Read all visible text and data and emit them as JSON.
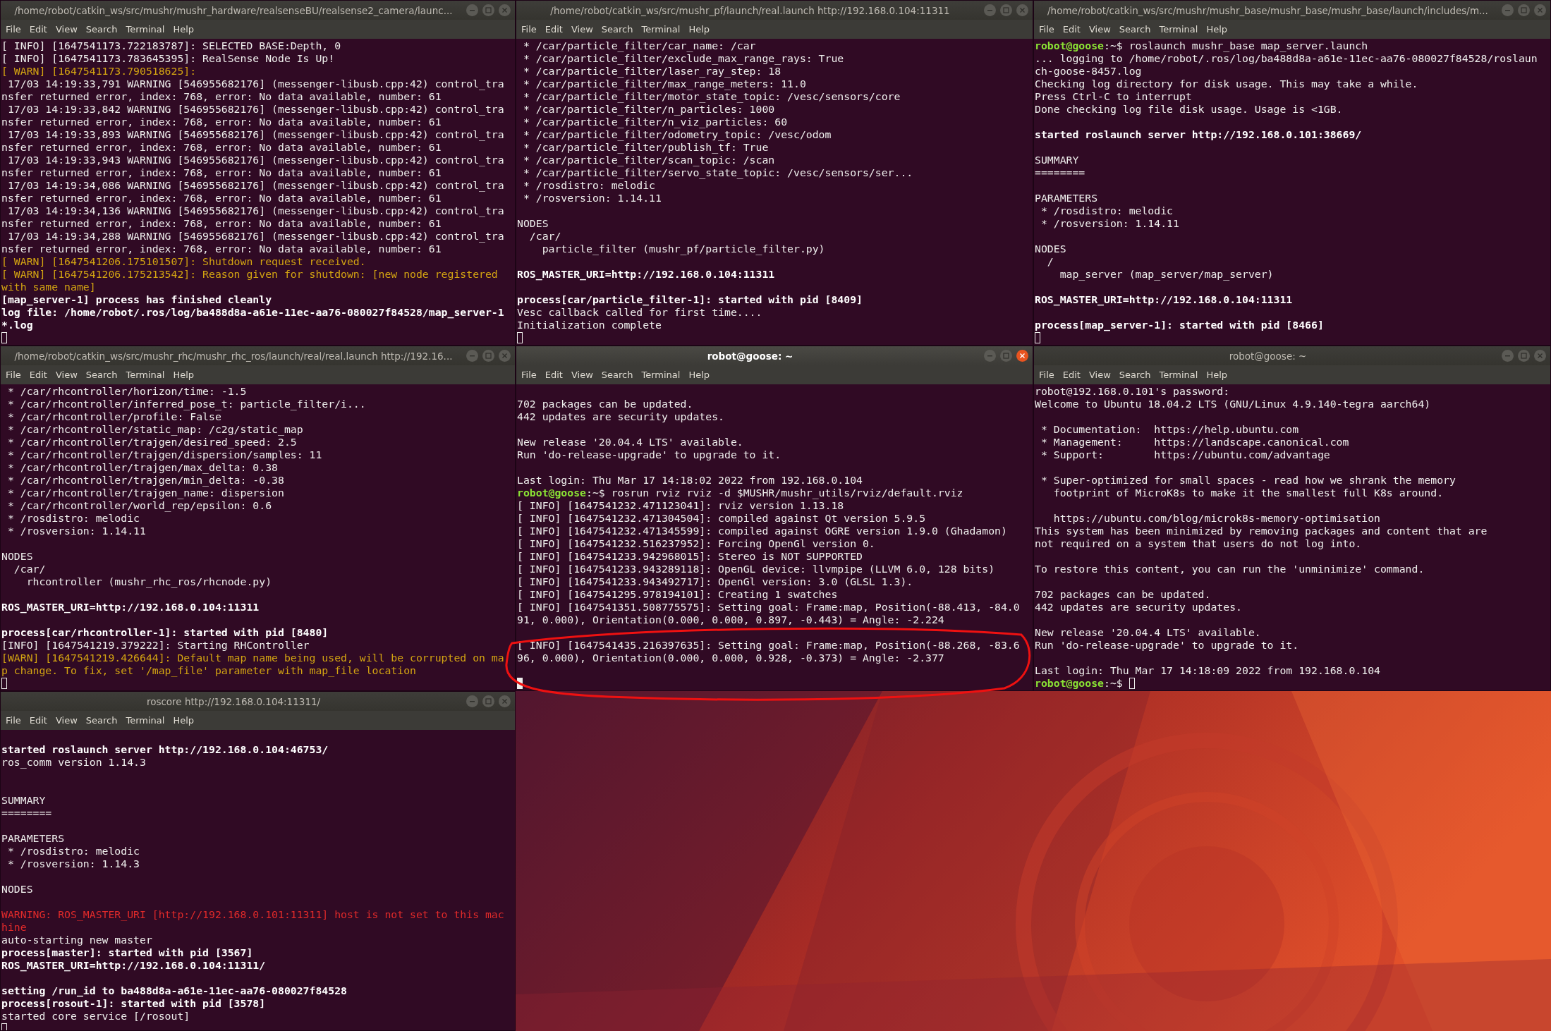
{
  "windows": [
    {
      "title": "/home/robot/catkin_ws/src/mushr/mushr_hardware/realsenseBU/realsense2_camera/launc...",
      "focused": false,
      "cursor_inline": false,
      "menu": [
        "File",
        "Edit",
        "View",
        "Search",
        "Terminal",
        "Help"
      ],
      "lines": [
        {
          "kind": "normal",
          "text": "[ INFO] [1647541173.722183787]: SELECTED BASE:Depth, 0"
        },
        {
          "kind": "normal",
          "text": "[ INFO] [1647541173.783645395]: RealSense Node Is Up!"
        },
        {
          "kind": "warn",
          "text": "[ WARN] [1647541173.790518625]:"
        },
        {
          "kind": "normal",
          "text": " 17/03 14:19:33,791 WARNING [546955682176] (messenger-libusb.cpp:42) control_tra"
        },
        {
          "kind": "normal",
          "text": "nsfer returned error, index: 768, error: No data available, number: 61"
        },
        {
          "kind": "normal",
          "text": " 17/03 14:19:33,842 WARNING [546955682176] (messenger-libusb.cpp:42) control_tra"
        },
        {
          "kind": "normal",
          "text": "nsfer returned error, index: 768, error: No data available, number: 61"
        },
        {
          "kind": "normal",
          "text": " 17/03 14:19:33,893 WARNING [546955682176] (messenger-libusb.cpp:42) control_tra"
        },
        {
          "kind": "normal",
          "text": "nsfer returned error, index: 768, error: No data available, number: 61"
        },
        {
          "kind": "normal",
          "text": " 17/03 14:19:33,943 WARNING [546955682176] (messenger-libusb.cpp:42) control_tra"
        },
        {
          "kind": "normal",
          "text": "nsfer returned error, index: 768, error: No data available, number: 61"
        },
        {
          "kind": "normal",
          "text": " 17/03 14:19:34,086 WARNING [546955682176] (messenger-libusb.cpp:42) control_tra"
        },
        {
          "kind": "normal",
          "text": "nsfer returned error, index: 768, error: No data available, number: 61"
        },
        {
          "kind": "normal",
          "text": " 17/03 14:19:34,136 WARNING [546955682176] (messenger-libusb.cpp:42) control_tra"
        },
        {
          "kind": "normal",
          "text": "nsfer returned error, index: 768, error: No data available, number: 61"
        },
        {
          "kind": "normal",
          "text": " 17/03 14:19:34,288 WARNING [546955682176] (messenger-libusb.cpp:42) control_tra"
        },
        {
          "kind": "normal",
          "text": "nsfer returned error, index: 768, error: No data available, number: 61"
        },
        {
          "kind": "warn",
          "text": "[ WARN] [1647541206.175101507]: Shutdown request received."
        },
        {
          "kind": "warn",
          "text": "[ WARN] [1647541206.175213542]: Reason given for shutdown: [new node registered"
        },
        {
          "kind": "warn",
          "text": "with same name]"
        },
        {
          "kind": "bold",
          "text": "[map_server-1] process has finished cleanly"
        },
        {
          "kind": "bold",
          "text": "log file: /home/robot/.ros/log/ba488d8a-a61e-11ec-aa76-080027f84528/map_server-1"
        },
        {
          "kind": "bold",
          "text": "*.log"
        }
      ]
    },
    {
      "title": "/home/robot/catkin_ws/src/mushr_pf/launch/real.launch http://192.168.0.104:11311",
      "focused": false,
      "cursor_inline": false,
      "menu": [
        "File",
        "Edit",
        "View",
        "Search",
        "Terminal",
        "Help"
      ],
      "lines": [
        {
          "kind": "normal",
          "text": " * /car/particle_filter/car_name: /car"
        },
        {
          "kind": "normal",
          "text": " * /car/particle_filter/exclude_max_range_rays: True"
        },
        {
          "kind": "normal",
          "text": " * /car/particle_filter/laser_ray_step: 18"
        },
        {
          "kind": "normal",
          "text": " * /car/particle_filter/max_range_meters: 11.0"
        },
        {
          "kind": "normal",
          "text": " * /car/particle_filter/motor_state_topic: /vesc/sensors/core"
        },
        {
          "kind": "normal",
          "text": " * /car/particle_filter/n_particles: 1000"
        },
        {
          "kind": "normal",
          "text": " * /car/particle_filter/n_viz_particles: 60"
        },
        {
          "kind": "normal",
          "text": " * /car/particle_filter/odometry_topic: /vesc/odom"
        },
        {
          "kind": "normal",
          "text": " * /car/particle_filter/publish_tf: True"
        },
        {
          "kind": "normal",
          "text": " * /car/particle_filter/scan_topic: /scan"
        },
        {
          "kind": "normal",
          "text": " * /car/particle_filter/servo_state_topic: /vesc/sensors/ser..."
        },
        {
          "kind": "normal",
          "text": " * /rosdistro: melodic"
        },
        {
          "kind": "normal",
          "text": " * /rosversion: 1.14.11"
        },
        {
          "kind": "blank"
        },
        {
          "kind": "normal",
          "text": "NODES"
        },
        {
          "kind": "normal",
          "text": "  /car/"
        },
        {
          "kind": "normal",
          "text": "    particle_filter (mushr_pf/particle_filter.py)"
        },
        {
          "kind": "blank"
        },
        {
          "kind": "bold",
          "text": "ROS_MASTER_URI=http://192.168.0.104:11311"
        },
        {
          "kind": "blank"
        },
        {
          "kind": "bold",
          "text": "process[car/particle_filter-1]: started with pid [8409]"
        },
        {
          "kind": "normal",
          "text": "Vesc callback called for first time...."
        },
        {
          "kind": "normal",
          "text": "Initialization complete"
        }
      ]
    },
    {
      "title": "/home/robot/catkin_ws/src/mushr/mushr_base/mushr_base/mushr_base/launch/includes/m...",
      "focused": false,
      "cursor_inline": false,
      "menu": [
        "File",
        "Edit",
        "View",
        "Search",
        "Terminal",
        "Help"
      ],
      "lines": [
        {
          "kind": "prompt",
          "user": "robot@goose",
          "text": ":~$ roslaunch mushr_base map_server.launch"
        },
        {
          "kind": "normal",
          "text": "... logging to /home/robot/.ros/log/ba488d8a-a61e-11ec-aa76-080027f84528/roslaun"
        },
        {
          "kind": "normal",
          "text": "ch-goose-8457.log"
        },
        {
          "kind": "normal",
          "text": "Checking log directory for disk usage. This may take a while."
        },
        {
          "kind": "normal",
          "text": "Press Ctrl-C to interrupt"
        },
        {
          "kind": "normal",
          "text": "Done checking log file disk usage. Usage is <1GB."
        },
        {
          "kind": "blank"
        },
        {
          "kind": "bold",
          "text": "started roslaunch server http://192.168.0.101:38669/"
        },
        {
          "kind": "blank"
        },
        {
          "kind": "normal",
          "text": "SUMMARY"
        },
        {
          "kind": "normal",
          "text": "========"
        },
        {
          "kind": "blank"
        },
        {
          "kind": "normal",
          "text": "PARAMETERS"
        },
        {
          "kind": "normal",
          "text": " * /rosdistro: melodic"
        },
        {
          "kind": "normal",
          "text": " * /rosversion: 1.14.11"
        },
        {
          "kind": "blank"
        },
        {
          "kind": "normal",
          "text": "NODES"
        },
        {
          "kind": "normal",
          "text": "  /"
        },
        {
          "kind": "normal",
          "text": "    map_server (map_server/map_server)"
        },
        {
          "kind": "blank"
        },
        {
          "kind": "bold",
          "text": "ROS_MASTER_URI=http://192.168.0.104:11311"
        },
        {
          "kind": "blank"
        },
        {
          "kind": "bold",
          "text": "process[map_server-1]: started with pid [8466]"
        }
      ]
    },
    {
      "title": "/home/robot/catkin_ws/src/mushr_rhc/mushr_rhc_ros/launch/real/real.launch http://192.16...",
      "focused": false,
      "cursor_inline": false,
      "menu": [
        "File",
        "Edit",
        "View",
        "Search",
        "Terminal",
        "Help"
      ],
      "lines": [
        {
          "kind": "normal",
          "text": " * /car/rhcontroller/horizon/time: -1.5"
        },
        {
          "kind": "normal",
          "text": " * /car/rhcontroller/inferred_pose_t: particle_filter/i..."
        },
        {
          "kind": "normal",
          "text": " * /car/rhcontroller/profile: False"
        },
        {
          "kind": "normal",
          "text": " * /car/rhcontroller/static_map: /c2g/static_map"
        },
        {
          "kind": "normal",
          "text": " * /car/rhcontroller/trajgen/desired_speed: 2.5"
        },
        {
          "kind": "normal",
          "text": " * /car/rhcontroller/trajgen/dispersion/samples: 11"
        },
        {
          "kind": "normal",
          "text": " * /car/rhcontroller/trajgen/max_delta: 0.38"
        },
        {
          "kind": "normal",
          "text": " * /car/rhcontroller/trajgen/min_delta: -0.38"
        },
        {
          "kind": "normal",
          "text": " * /car/rhcontroller/trajgen_name: dispersion"
        },
        {
          "kind": "normal",
          "text": " * /car/rhcontroller/world_rep/epsilon: 0.6"
        },
        {
          "kind": "normal",
          "text": " * /rosdistro: melodic"
        },
        {
          "kind": "normal",
          "text": " * /rosversion: 1.14.11"
        },
        {
          "kind": "blank"
        },
        {
          "kind": "normal",
          "text": "NODES"
        },
        {
          "kind": "normal",
          "text": "  /car/"
        },
        {
          "kind": "normal",
          "text": "    rhcontroller (mushr_rhc_ros/rhcnode.py)"
        },
        {
          "kind": "blank"
        },
        {
          "kind": "bold",
          "text": "ROS_MASTER_URI=http://192.168.0.104:11311"
        },
        {
          "kind": "blank"
        },
        {
          "kind": "bold",
          "text": "process[car/rhcontroller-1]: started with pid [8480]"
        },
        {
          "kind": "normal",
          "text": "[INFO] [1647541219.379222]: Starting RHController"
        },
        {
          "kind": "warn",
          "text": "[WARN] [1647541219.426644]: Default map name being used, will be corrupted on ma"
        },
        {
          "kind": "warn",
          "text": "p change. To fix, set '/map_file' parameter with map_file location"
        }
      ]
    },
    {
      "title": "robot@goose: ~",
      "focused": true,
      "cursor_inline": false,
      "menu": [
        "File",
        "Edit",
        "View",
        "Search",
        "Terminal",
        "Help"
      ],
      "lines": [
        {
          "kind": "blank"
        },
        {
          "kind": "normal",
          "text": "702 packages can be updated."
        },
        {
          "kind": "normal",
          "text": "442 updates are security updates."
        },
        {
          "kind": "blank"
        },
        {
          "kind": "normal",
          "text": "New release '20.04.4 LTS' available."
        },
        {
          "kind": "normal",
          "text": "Run 'do-release-upgrade' to upgrade to it."
        },
        {
          "kind": "blank"
        },
        {
          "kind": "normal",
          "text": "Last login: Thu Mar 17 14:18:02 2022 from 192.168.0.104"
        },
        {
          "kind": "prompt",
          "user": "robot@goose",
          "text": ":~$ rosrun rviz rviz -d $MUSHR/mushr_utils/rviz/default.rviz"
        },
        {
          "kind": "normal",
          "text": "[ INFO] [1647541232.471123041]: rviz version 1.13.18"
        },
        {
          "kind": "normal",
          "text": "[ INFO] [1647541232.471304504]: compiled against Qt version 5.9.5"
        },
        {
          "kind": "normal",
          "text": "[ INFO] [1647541232.471345599]: compiled against OGRE version 1.9.0 (Ghadamon)"
        },
        {
          "kind": "normal",
          "text": "[ INFO] [1647541232.516237952]: Forcing OpenGl version 0."
        },
        {
          "kind": "normal",
          "text": "[ INFO] [1647541233.942968015]: Stereo is NOT SUPPORTED"
        },
        {
          "kind": "normal",
          "text": "[ INFO] [1647541233.943289118]: OpenGL device: llvmpipe (LLVM 6.0, 128 bits)"
        },
        {
          "kind": "normal",
          "text": "[ INFO] [1647541233.943492717]: OpenGl version: 3.0 (GLSL 1.3)."
        },
        {
          "kind": "normal",
          "text": "[ INFO] [1647541295.978194101]: Creating 1 swatches"
        },
        {
          "kind": "normal",
          "text": "[ INFO] [1647541351.508775575]: Setting goal: Frame:map, Position(-88.413, -84.0"
        },
        {
          "kind": "normal",
          "text": "91, 0.000), Orientation(0.000, 0.000, 0.897, -0.443) = Angle: -2.224"
        },
        {
          "kind": "blank"
        },
        {
          "kind": "normal",
          "text": "[ INFO] [1647541435.216397635]: Setting goal: Frame:map, Position(-88.268, -83.6"
        },
        {
          "kind": "normal",
          "text": "96, 0.000), Orientation(0.000, 0.000, 0.928, -0.373) = Angle: -2.377"
        },
        {
          "kind": "blank"
        }
      ]
    },
    {
      "title": "robot@goose: ~",
      "focused": false,
      "cursor_inline": true,
      "menu": [
        "File",
        "Edit",
        "View",
        "Search",
        "Terminal",
        "Help"
      ],
      "lines": [
        {
          "kind": "normal",
          "text": "robot@192.168.0.101's password:"
        },
        {
          "kind": "normal",
          "text": "Welcome to Ubuntu 18.04.2 LTS (GNU/Linux 4.9.140-tegra aarch64)"
        },
        {
          "kind": "blank"
        },
        {
          "kind": "normal",
          "text": " * Documentation:  https://help.ubuntu.com"
        },
        {
          "kind": "normal",
          "text": " * Management:     https://landscape.canonical.com"
        },
        {
          "kind": "normal",
          "text": " * Support:        https://ubuntu.com/advantage"
        },
        {
          "kind": "blank"
        },
        {
          "kind": "normal",
          "text": " * Super-optimized for small spaces - read how we shrank the memory"
        },
        {
          "kind": "normal",
          "text": "   footprint of MicroK8s to make it the smallest full K8s around."
        },
        {
          "kind": "blank"
        },
        {
          "kind": "normal",
          "text": "   https://ubuntu.com/blog/microk8s-memory-optimisation"
        },
        {
          "kind": "normal",
          "text": "This system has been minimized by removing packages and content that are"
        },
        {
          "kind": "normal",
          "text": "not required on a system that users do not log into."
        },
        {
          "kind": "blank"
        },
        {
          "kind": "normal",
          "text": "To restore this content, you can run the 'unminimize' command."
        },
        {
          "kind": "blank"
        },
        {
          "kind": "normal",
          "text": "702 packages can be updated."
        },
        {
          "kind": "normal",
          "text": "442 updates are security updates."
        },
        {
          "kind": "blank"
        },
        {
          "kind": "normal",
          "text": "New release '20.04.4 LTS' available."
        },
        {
          "kind": "normal",
          "text": "Run 'do-release-upgrade' to upgrade to it."
        },
        {
          "kind": "blank"
        },
        {
          "kind": "normal",
          "text": "Last login: Thu Mar 17 14:18:09 2022 from 192.168.0.104"
        },
        {
          "kind": "prompt",
          "user": "robot@goose",
          "text": ":~$ "
        }
      ]
    },
    {
      "title": "roscore http://192.168.0.104:11311/",
      "focused": false,
      "cursor_inline": false,
      "menu": [
        "File",
        "Edit",
        "View",
        "Search",
        "Terminal",
        "Help"
      ],
      "lines": [
        {
          "kind": "blank"
        },
        {
          "kind": "bold",
          "text": "started roslaunch server http://192.168.0.104:46753/"
        },
        {
          "kind": "normal",
          "text": "ros_comm version 1.14.3"
        },
        {
          "kind": "blank"
        },
        {
          "kind": "blank"
        },
        {
          "kind": "normal",
          "text": "SUMMARY"
        },
        {
          "kind": "normal",
          "text": "========"
        },
        {
          "kind": "blank"
        },
        {
          "kind": "normal",
          "text": "PARAMETERS"
        },
        {
          "kind": "normal",
          "text": " * /rosdistro: melodic"
        },
        {
          "kind": "normal",
          "text": " * /rosversion: 1.14.3"
        },
        {
          "kind": "blank"
        },
        {
          "kind": "normal",
          "text": "NODES"
        },
        {
          "kind": "blank"
        },
        {
          "kind": "error",
          "text": "WARNING: ROS_MASTER_URI [http://192.168.0.101:11311] host is not set to this mac"
        },
        {
          "kind": "error",
          "text": "hine"
        },
        {
          "kind": "normal",
          "text": "auto-starting new master"
        },
        {
          "kind": "bold",
          "text": "process[master]: started with pid [3567]"
        },
        {
          "kind": "bold",
          "text": "ROS_MASTER_URI=http://192.168.0.104:11311/"
        },
        {
          "kind": "blank"
        },
        {
          "kind": "bold",
          "text": "setting /run_id to ba488d8a-a61e-11ec-aa76-080027f84528"
        },
        {
          "kind": "bold",
          "text": "process[rosout-1]: started with pid [3578]"
        },
        {
          "kind": "normal",
          "text": "started core service [/rosout]"
        }
      ]
    }
  ]
}
